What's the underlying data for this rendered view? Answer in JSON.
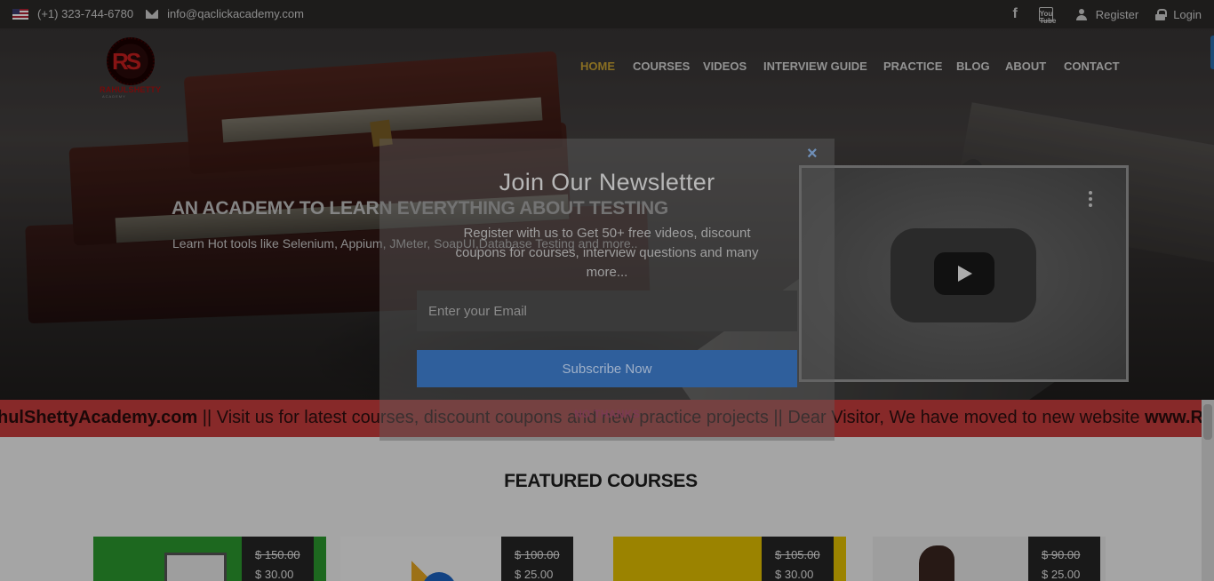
{
  "topbar": {
    "phone": "(+1) 323-744-6780",
    "email": "info@qaclickacademy.com",
    "register": "Register",
    "login": "Login",
    "youtube_glyph": "You Tube"
  },
  "logo": {
    "initials": "RS",
    "name": "RAHULSHETTY",
    "tagline": "ACADEMY"
  },
  "nav": {
    "items": [
      "HOME",
      "COURSES",
      "VIDEOS",
      "INTERVIEW GUIDE",
      "PRACTICE",
      "BLOG",
      "ABOUT",
      "CONTACT"
    ],
    "active": "HOME"
  },
  "hero": {
    "title": "AN ACADEMY TO LEARN EVERYTHING ABOUT TESTING",
    "subtitle": "Learn Hot tools like Selenium, Appium, JMeter, SoapUI,Database Testing and more.."
  },
  "ticker": {
    "part1": "hulShettyAcademy.com",
    "part2": " || Visit us for latest courses, discount coupons and new practice projects || Dear Visitor, We have moved to new website ",
    "part3": "www.RahulShettyAca"
  },
  "featured": {
    "title": "FEATURED COURSES",
    "courses": [
      {
        "old_price": "$ 150.00",
        "price": "$ 30.00"
      },
      {
        "old_price": "$ 100.00",
        "price": "$ 25.00"
      },
      {
        "old_price": "$ 105.00",
        "price": "$ 30.00"
      },
      {
        "old_price": "$ 90.00",
        "price": "$ 25.00"
      }
    ]
  },
  "modal": {
    "close": "×",
    "title": "Join Our Newsletter",
    "description": "Register with us to Get 50+ free videos, discount coupons for courses, interview questions and many more...",
    "email_placeholder": "Enter your Email",
    "subscribe": "Subscribe Now",
    "no_thanks": "NO THANKS"
  },
  "colors": {
    "nav_active": "#c9a233",
    "ticker_bg": "#c73d3d",
    "subscribe_bg": "#2f5f9c"
  }
}
